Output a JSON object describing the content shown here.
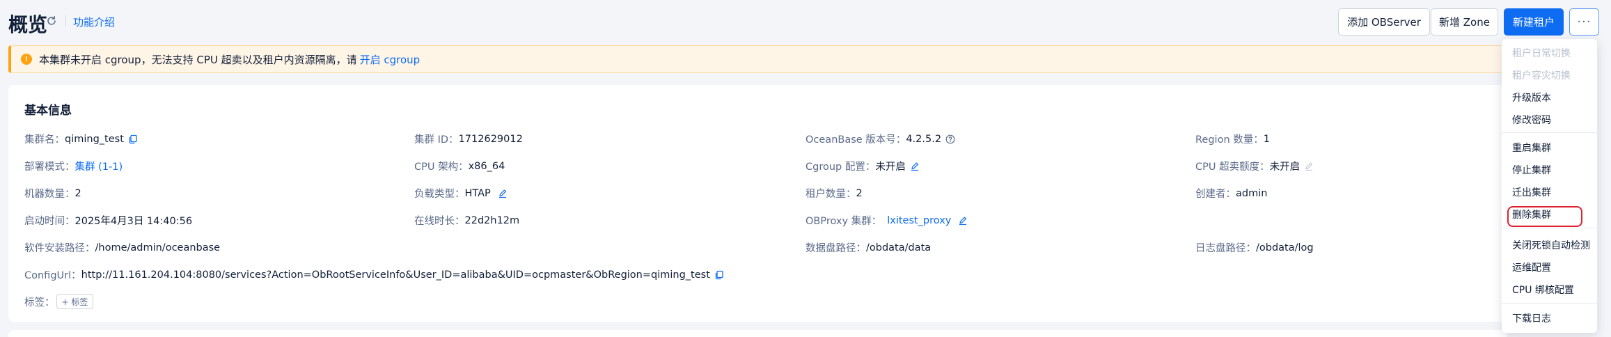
{
  "header": {
    "title": "概览",
    "feature_link": "功能介绍",
    "buttons": {
      "add_observer": "添加 OBServer",
      "add_zone": "新增 Zone",
      "new_tenant": "新建租户",
      "more": "···"
    }
  },
  "alert": {
    "icon": "!",
    "message": "本集群未开启 cgroup，无法支持 CPU 超卖以及租户内资源隔离，请",
    "link": "开启 cgroup"
  },
  "basic_info": {
    "title": "基本信息",
    "cluster_name": {
      "label": "集群名：",
      "value": "qiming_test"
    },
    "cluster_id": {
      "label": "集群 ID：",
      "value": "1712629012"
    },
    "ob_version": {
      "label": "OceanBase 版本号：",
      "value": "4.2.5.2"
    },
    "region_count": {
      "label": "Region 数量：",
      "value": "1"
    },
    "deploy_mode": {
      "label": "部署模式：",
      "value": "集群 (1-1)"
    },
    "cpu_arch": {
      "label": "CPU 架构：",
      "value": "x86_64"
    },
    "cgroup": {
      "label": "Cgroup 配置：",
      "value": "未开启"
    },
    "cpu_oversell": {
      "label": "CPU 超卖额度：",
      "value": "未开启"
    },
    "machine_count": {
      "label": "机器数量：",
      "value": "2"
    },
    "load_type": {
      "label": "负载类型：",
      "value": "HTAP"
    },
    "tenant_count": {
      "label": "租户数量：",
      "value": "2"
    },
    "creator": {
      "label": "创建者：",
      "value": "admin"
    },
    "start_time": {
      "label": "启动时间：",
      "value": "2025年4月3日 14:40:56"
    },
    "online_duration": {
      "label": "在线时长：",
      "value": "22d2h12m"
    },
    "obproxy": {
      "label": "OBProxy 集群：",
      "value": "lxitest_proxy"
    },
    "install_path": {
      "label": "软件安装路径：",
      "value": "/home/admin/oceanbase"
    },
    "data_path": {
      "label": "数据盘路径：",
      "value": "/obdata/data"
    },
    "log_path": {
      "label": "日志盘路径：",
      "value": "/obdata/log"
    },
    "config_url": {
      "label": "ConfigUrl：",
      "value": "http://11.161.204.104:8080/services?Action=ObRootServiceInfo&User_ID=alibaba&UID=ocpmaster&ObRegion=qiming_test"
    },
    "tags": {
      "label": "标签：",
      "add": "+ 标签"
    }
  },
  "menu": {
    "items": [
      {
        "label": "租户日常切换",
        "disabled": true
      },
      {
        "label": "租户容灾切换",
        "disabled": true
      },
      {
        "label": "升级版本"
      },
      {
        "label": "修改密码"
      },
      {
        "label": "重启集群"
      },
      {
        "label": "停止集群"
      },
      {
        "label": "迁出集群"
      },
      {
        "label": "删除集群"
      },
      {
        "label": "关闭死锁自动检测"
      },
      {
        "label": "运维配置"
      },
      {
        "label": "CPU 绑核配置"
      },
      {
        "label": "下载日志"
      }
    ]
  },
  "colors": {
    "primary": "#0d6cf2",
    "warning": "#ffa20f",
    "highlight": "#e0202e"
  }
}
